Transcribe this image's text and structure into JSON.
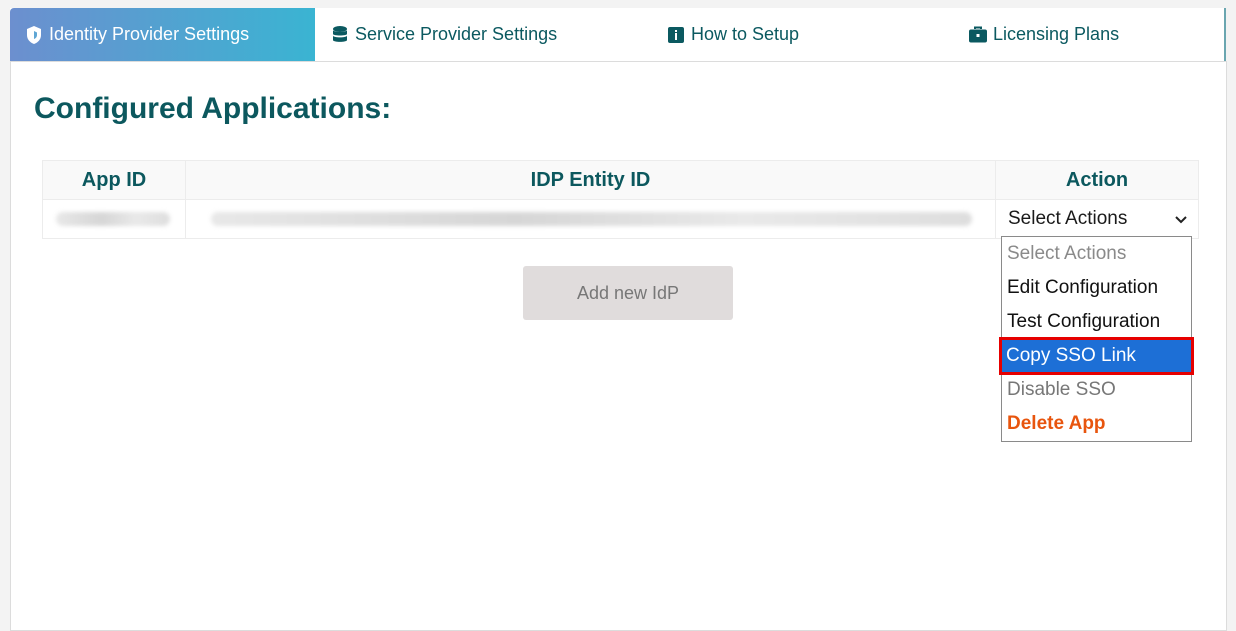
{
  "tabs": [
    {
      "label": "Identity Provider Settings",
      "icon": "shield-icon",
      "active": true
    },
    {
      "label": "Service Provider Settings",
      "icon": "database-icon",
      "active": false
    },
    {
      "label": "How to Setup",
      "icon": "info-icon",
      "active": false
    },
    {
      "label": "Licensing Plans",
      "icon": "briefcase-icon",
      "active": false
    }
  ],
  "main": {
    "title": "Configured Applications:",
    "table": {
      "headers": [
        "App ID",
        "IDP Entity ID",
        "Action"
      ],
      "rows": [
        {
          "app_id": "",
          "idp_entity_id": "",
          "action": "Select Actions"
        }
      ]
    },
    "add_button": "Add new IdP"
  },
  "dropdown": {
    "options": [
      "Select Actions",
      "Edit Configuration",
      "Test Configuration",
      "Copy SSO Link",
      "Disable SSO",
      "Delete App"
    ],
    "selected": "Copy SSO Link"
  },
  "colors": {
    "accent": "#0c585e",
    "selected": "#1d6fd6",
    "highlight_border": "#e60000",
    "danger": "#e8550e"
  }
}
